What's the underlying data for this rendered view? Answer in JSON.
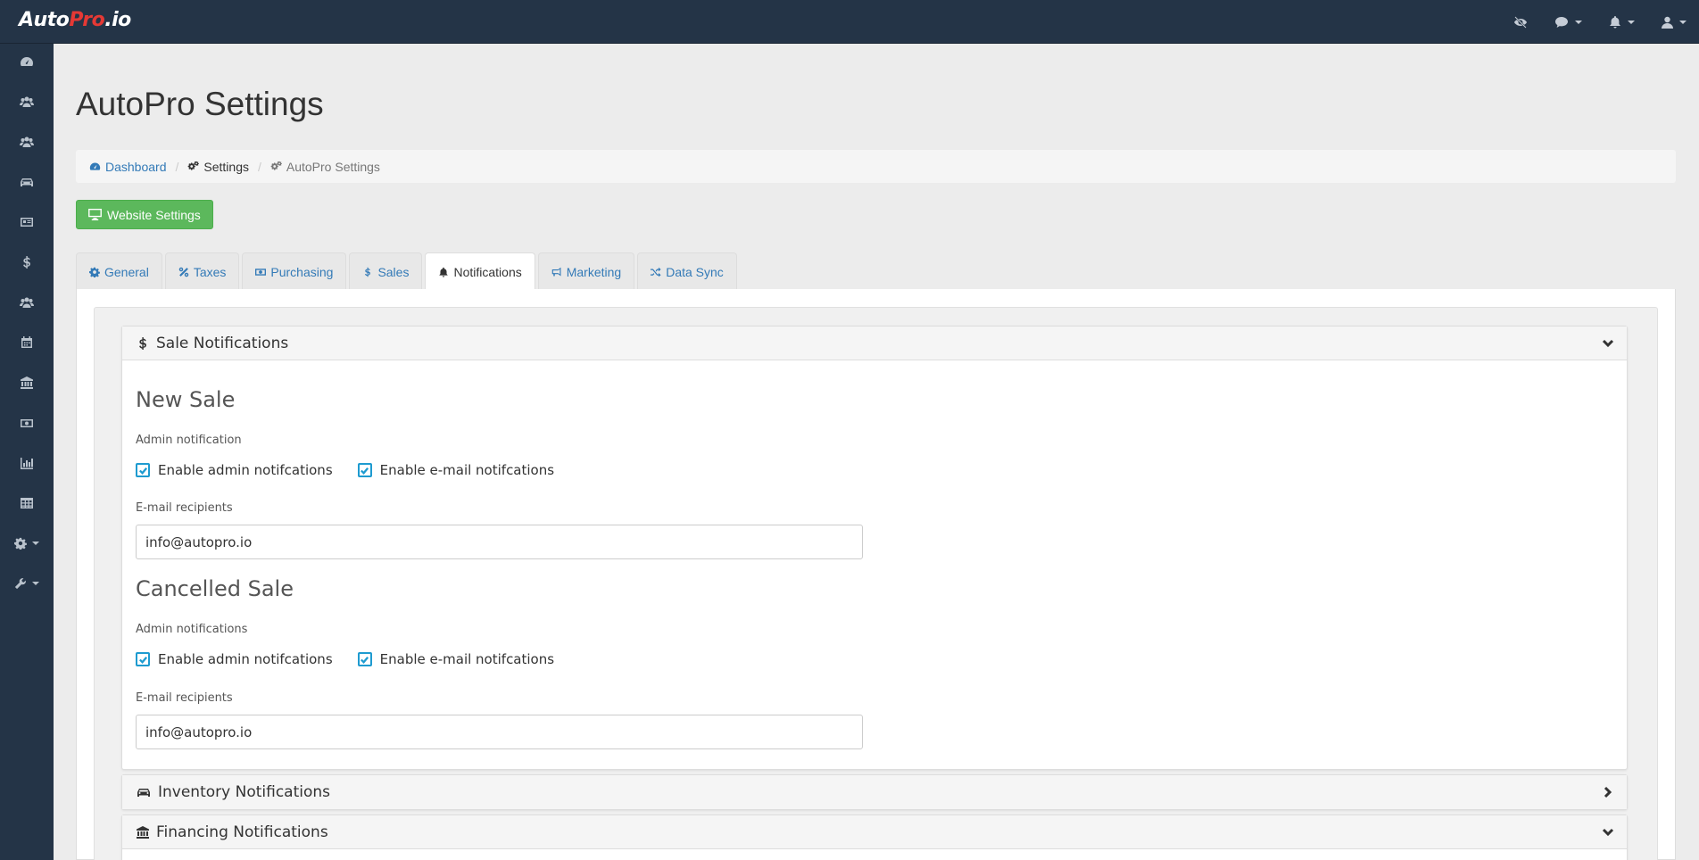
{
  "app": {
    "logo_prefix": "Auto",
    "logo_accent": "Pro",
    "logo_suffix": ".io"
  },
  "topbar": {
    "icons": [
      "eye-slash-icon",
      "comment-icon",
      "bell-icon",
      "user-icon"
    ]
  },
  "sidebar": {
    "items": [
      "dashboard-icon",
      "users-icon",
      "users-icon",
      "car-icon",
      "id-card-icon",
      "dollar-icon",
      "users-icon",
      "calendar-icon",
      "bank-icon",
      "money-icon",
      "bar-chart-icon",
      "table-icon",
      "gear-icon",
      "wrench-icon"
    ]
  },
  "page": {
    "title": "AutoPro Settings"
  },
  "breadcrumb": {
    "dashboard": "Dashboard",
    "settings": "Settings",
    "current": "AutoPro Settings"
  },
  "actions": {
    "website_settings": "Website Settings"
  },
  "tabs": {
    "general": "General",
    "taxes": "Taxes",
    "purchasing": "Purchasing",
    "sales": "Sales",
    "notifications": "Notifications",
    "marketing": "Marketing",
    "data_sync": "Data Sync",
    "active": "Notifications"
  },
  "sale_panel": {
    "title": "Sale Notifications",
    "new_sale": {
      "heading": "New Sale",
      "sublabel": "Admin notification",
      "check_admin": "Enable admin notifcations",
      "check_email": "Enable e-mail notifcations",
      "admin_checked": true,
      "email_checked": true,
      "recipients_label": "E-mail recipients",
      "recipients_value": "info@autopro.io"
    },
    "cancelled_sale": {
      "heading": "Cancelled Sale",
      "sublabel": "Admin notifications",
      "check_admin": "Enable admin notifcations",
      "check_email": "Enable e-mail notifcations",
      "admin_checked": true,
      "email_checked": true,
      "recipients_label": "E-mail recipients",
      "recipients_value": "info@autopro.io"
    }
  },
  "inventory_panel": {
    "title": "Inventory Notifications"
  },
  "financing_panel": {
    "title": "Financing Notifications"
  },
  "colors": {
    "topbar": "#243447",
    "accent_link": "#337ab7",
    "success_button": "#5cb85c",
    "checkbox": "#1e9bd0",
    "logo_accent": "#e53935"
  }
}
